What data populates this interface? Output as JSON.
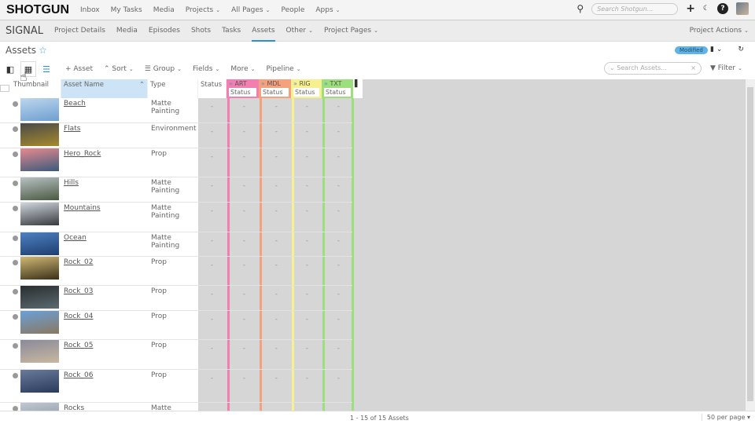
{
  "topnav": {
    "logo": "SHOTGUN",
    "items": [
      {
        "label": "Inbox"
      },
      {
        "label": "My Tasks"
      },
      {
        "label": "Media"
      },
      {
        "label": "Projects",
        "dropdown": true
      },
      {
        "label": "All Pages",
        "dropdown": true
      },
      {
        "label": "People"
      },
      {
        "label": "Apps",
        "dropdown": true
      }
    ],
    "search_placeholder": "Search Shotgun..."
  },
  "subnav": {
    "project": "SIGNAL",
    "items": [
      {
        "label": "Project Details"
      },
      {
        "label": "Media"
      },
      {
        "label": "Episodes"
      },
      {
        "label": "Shots"
      },
      {
        "label": "Tasks"
      },
      {
        "label": "Assets",
        "active": true
      },
      {
        "label": "Other",
        "dropdown": true
      },
      {
        "label": "Project Pages",
        "dropdown": true
      }
    ],
    "project_actions": "Project Actions"
  },
  "page": {
    "title": "Assets",
    "badge": "Modified"
  },
  "toolbar": {
    "add": "+ Asset",
    "sort": "Sort",
    "group": "Group",
    "fields": "Fields",
    "more": "More",
    "pipeline": "Pipeline",
    "search_placeholder": "Search Assets...",
    "filter": "Filter"
  },
  "columns": {
    "thumbnail": "Thumbnail",
    "name": "Asset Name",
    "type": "Type",
    "status": "Status"
  },
  "pipeline_steps": [
    {
      "label": "ART",
      "sub": "Status",
      "color": "#f27fb0"
    },
    {
      "label": "MDL",
      "sub": "Status",
      "color": "#f5a27c"
    },
    {
      "label": "RIG",
      "sub": "Status",
      "color": "#f7f08c"
    },
    {
      "label": "TXT",
      "sub": "Status",
      "color": "#9ce07c"
    }
  ],
  "rows": [
    {
      "name": "Beach",
      "type": "Matte Painting",
      "thumb": [
        "#bcd6ee",
        "#6f9fcf"
      ]
    },
    {
      "name": "Flats",
      "type": "Environment",
      "thumb": [
        "#4a4a48",
        "#a68a2e"
      ]
    },
    {
      "name": "Hero_Rock",
      "type": "Prop",
      "thumb": [
        "#e78a8f",
        "#3a5a7a"
      ]
    },
    {
      "name": "Hills",
      "type": "Matte Painting",
      "thumb": [
        "#b7c0c4",
        "#4a5a40"
      ]
    },
    {
      "name": "Mountains",
      "type": "Matte Painting",
      "thumb": [
        "#cfd6dc",
        "#353a3e"
      ]
    },
    {
      "name": "Ocean",
      "type": "Matte Painting",
      "thumb": [
        "#4f80c0",
        "#1c3f70"
      ]
    },
    {
      "name": "Rock_02",
      "type": "Prop",
      "thumb": [
        "#cfb874",
        "#3a3018"
      ]
    },
    {
      "name": "Rock_03",
      "type": "Prop",
      "thumb": [
        "#2a2e30",
        "#5a6a70"
      ]
    },
    {
      "name": "Rock_04",
      "type": "Prop",
      "thumb": [
        "#6aa0d8",
        "#8a7860"
      ]
    },
    {
      "name": "Rock_05",
      "type": "Prop",
      "thumb": [
        "#8a8a9a",
        "#c8b8a0"
      ]
    },
    {
      "name": "Rock_06",
      "type": "Prop",
      "thumb": [
        "#6a7a9a",
        "#2a3a5a"
      ]
    },
    {
      "name": "Rocks",
      "type": "Matte Painting",
      "thumb": [
        "#c0c8d0",
        "#8090a0"
      ]
    }
  ],
  "empty_value": "-",
  "footer": {
    "count": "1 - 15 of 15 Assets",
    "per_page": "50 per page"
  }
}
